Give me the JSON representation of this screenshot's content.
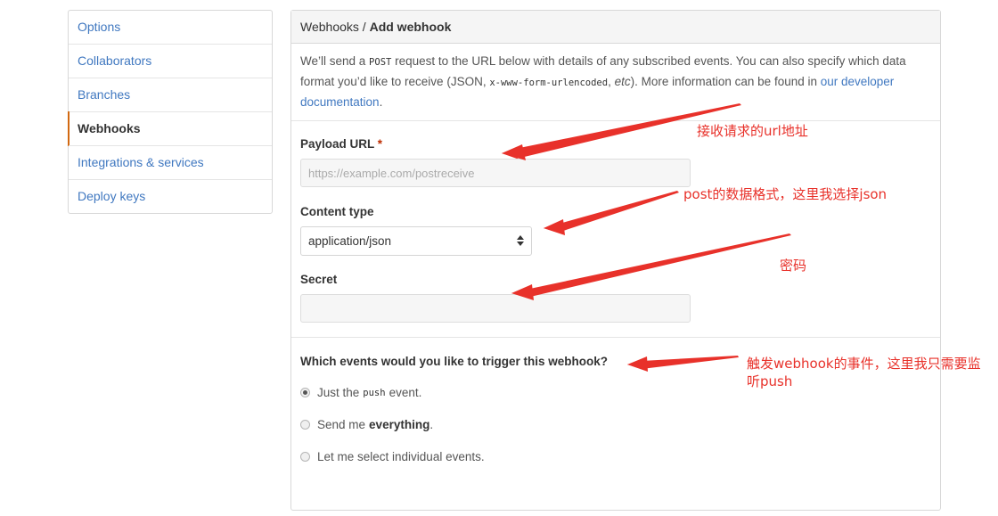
{
  "sidebar": {
    "items": [
      {
        "label": "Options"
      },
      {
        "label": "Collaborators"
      },
      {
        "label": "Branches"
      },
      {
        "label": "Webhooks"
      },
      {
        "label": "Integrations & services"
      },
      {
        "label": "Deploy keys"
      }
    ],
    "selected": "Webhooks"
  },
  "header": {
    "breadcrumb_parent": "Webhooks",
    "separator": "/",
    "breadcrumb_current": "Add webhook"
  },
  "intro": {
    "text1": "We’ll send a ",
    "code1": "POST",
    "text2": " request to the URL below with details of any subscribed events. You can also specify which data format you’d like to receive (JSON, ",
    "code2": "x-www-form-urlencoded",
    "text3": ", ",
    "em1": "etc",
    "text4": "). More information can be found in ",
    "link": "our developer documentation",
    "text5": "."
  },
  "form": {
    "payload_url_label": "Payload URL",
    "required_mark": "*",
    "payload_url_placeholder": "https://example.com/postreceive",
    "content_type_label": "Content type",
    "content_type_value": "application/json",
    "secret_label": "Secret",
    "secret_value": ""
  },
  "events": {
    "question": "Which events would you like to trigger this webhook?",
    "options": [
      {
        "before": "Just the",
        "code": "push",
        "after": "event.",
        "checked": true
      },
      {
        "before": "Send me",
        "bold": "everything",
        "after": ".",
        "checked": false
      },
      {
        "before": "Let me select individual events.",
        "checked": false
      }
    ]
  },
  "annotations": {
    "payload": "接收请求的url地址",
    "content_type": "post的数据格式，这里我选择json",
    "secret": "密码",
    "events_line1": "触发webhook的事件，这里我只需要监",
    "events_line2": "听push"
  },
  "colors": {
    "link": "#4078c0",
    "selected_accent": "#d26911",
    "annotation": "#e8312a"
  }
}
